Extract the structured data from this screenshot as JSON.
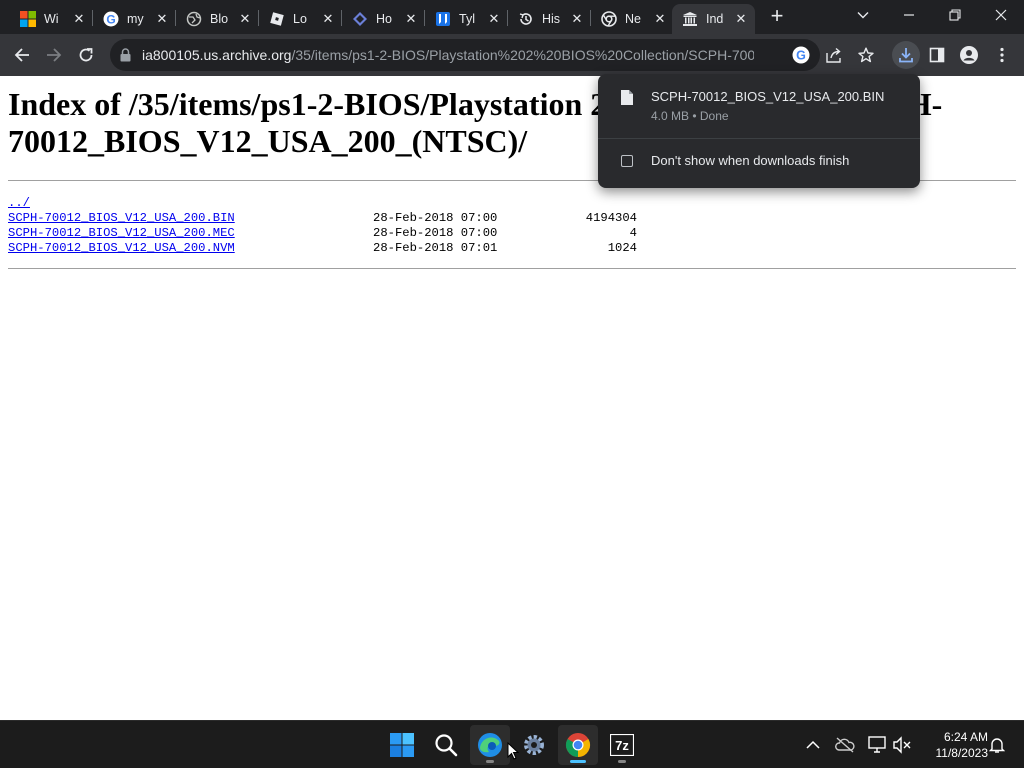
{
  "tabs": [
    {
      "title": "Wi",
      "icon": "microsoft-icon"
    },
    {
      "title": "my",
      "icon": "google-icon"
    },
    {
      "title": "Blo",
      "icon": "globe-icon"
    },
    {
      "title": "Lo",
      "icon": "roblox-icon"
    },
    {
      "title": "Ho",
      "icon": "site-icon"
    },
    {
      "title": "Tyl",
      "icon": "bookmark-icon"
    },
    {
      "title": "His",
      "icon": "history-icon"
    },
    {
      "title": "Ne",
      "icon": "chrome-icon"
    },
    {
      "title": "Ind",
      "icon": "archive-icon",
      "active": true
    }
  ],
  "omnibox": {
    "host": "ia800105.us.archive.org",
    "path": "/35/items/ps1-2-BIOS/Playstation%202%20BIOS%20Collection/SCPH-70012_BI..."
  },
  "page": {
    "heading": "Index of /35/items/ps1-2-BIOS/Playstation 2 BIOS Collection/SCPH-70012_BIOS_V12_USA_200_(NTSC)/",
    "parent_link": "../",
    "files": [
      {
        "name": "SCPH-70012_BIOS_V12_USA_200.BIN",
        "date": "28-Feb-2018 07:00",
        "size": "4194304"
      },
      {
        "name": "SCPH-70012_BIOS_V12_USA_200.MEC",
        "date": "28-Feb-2018 07:00",
        "size": "4"
      },
      {
        "name": "SCPH-70012_BIOS_V12_USA_200.NVM",
        "date": "28-Feb-2018 07:01",
        "size": "1024"
      }
    ]
  },
  "downloads": {
    "filename": "SCPH-70012_BIOS_V12_USA_200.BIN",
    "status": "4.0 MB • Done",
    "checkbox_label": "Don't show when downloads finish",
    "checked": false
  },
  "taskbar": {
    "time": "6:24 AM",
    "date": "11/8/2023",
    "apps": [
      "start-icon",
      "search-icon",
      "edge-icon",
      "settings-icon",
      "chrome-icon",
      "7zip-icon"
    ],
    "sevenzip_label": "7z"
  },
  "colors": {
    "chrome_dark": "#202124",
    "toolbar": "#35363a",
    "link": "#0000ee",
    "accent": "#4cc2ff"
  }
}
